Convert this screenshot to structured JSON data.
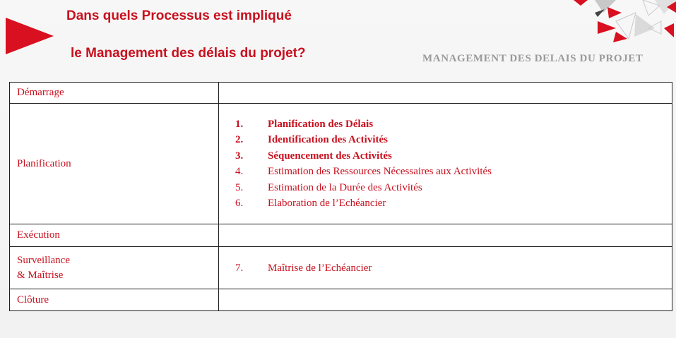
{
  "colors": {
    "accent_red": "#c8101e",
    "section_gray": "#9a9a9a",
    "border": "#1f1f1f"
  },
  "header": {
    "title_line1": "Dans quels Processus est impliqué",
    "title_line2": "le Management des délais du projet?",
    "section_label": "MANAGEMENT DES DELAIS DU PROJET"
  },
  "table": {
    "rows": [
      {
        "phase_lines": [
          "Démarrage"
        ],
        "processes": []
      },
      {
        "phase_lines": [
          "Planification"
        ],
        "processes": [
          {
            "num": "1.",
            "text": "Planification des Délais",
            "bold": true
          },
          {
            "num": "2.",
            "text": "Identification des Activités",
            "bold": true
          },
          {
            "num": "3.",
            "text": "Séquencement des Activités",
            "bold": true
          },
          {
            "num": "4.",
            "text": "Estimation des Ressources Nécessaires aux Activités",
            "bold": false
          },
          {
            "num": "5.",
            "text": "Estimation de la Durée des Activités",
            "bold": false
          },
          {
            "num": "6.",
            "text": "Elaboration de l’Echéancier",
            "bold": false
          }
        ]
      },
      {
        "phase_lines": [
          "Exécution"
        ],
        "processes": []
      },
      {
        "phase_lines": [
          "Surveillance",
          "& Maîtrise"
        ],
        "processes": [
          {
            "num": "7.",
            "text": "Maîtrise de l’Echéancier",
            "bold": false
          }
        ]
      },
      {
        "phase_lines": [
          "Clôture"
        ],
        "processes": []
      }
    ]
  }
}
